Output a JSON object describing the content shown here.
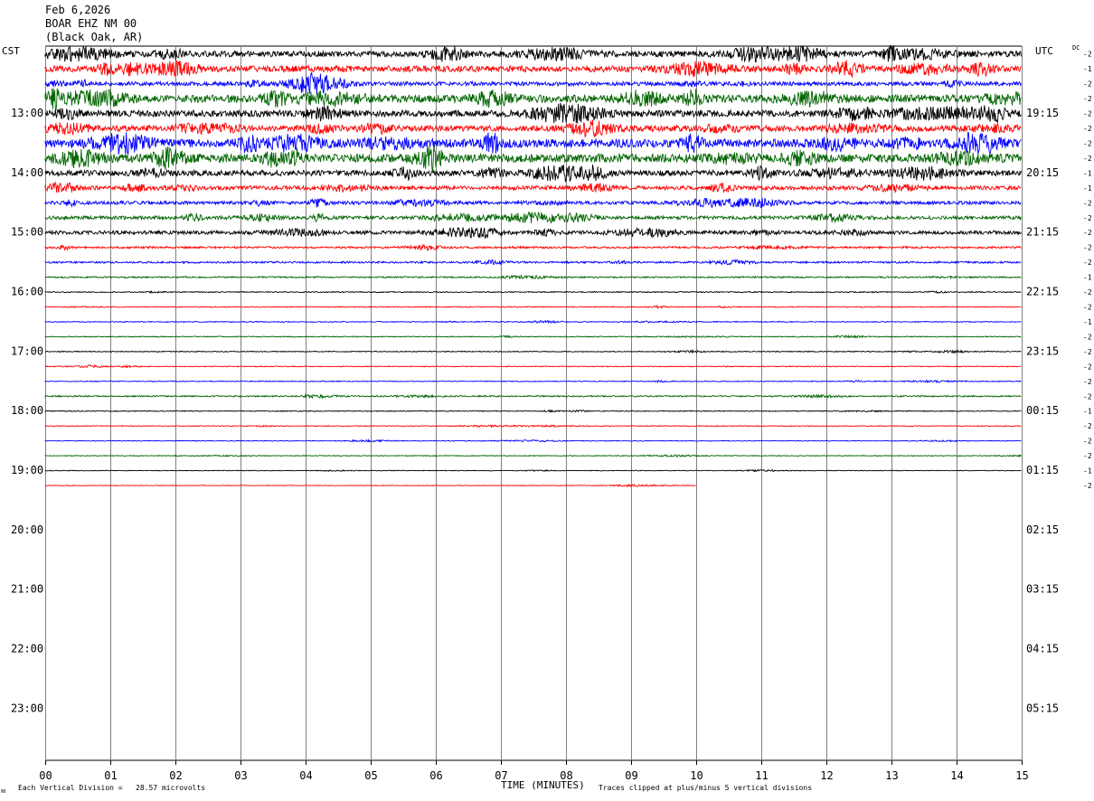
{
  "header": {
    "date": "Feb 6,2026",
    "station": "BOAR EHZ NM 00",
    "location": "(Black Oak, AR)"
  },
  "left_tz": "CST",
  "right_tz": "UTC",
  "dc_label": "DC",
  "footer": {
    "scale_note": "Each Vertical Division =   28.57 microvolts",
    "clip_note": "Traces clipped at plus/minus 5 vertical divisions",
    "corner_mark": "ᴍ"
  },
  "colors": {
    "cycle": [
      "#000000",
      "#ff0000",
      "#0000ff",
      "#006400"
    ],
    "grid": "#808080"
  },
  "chart_data": {
    "type": "line",
    "xlabel": "TIME (MINUTES)",
    "xlim": [
      0,
      15
    ],
    "x_ticks": [
      "00",
      "01",
      "02",
      "03",
      "04",
      "05",
      "06",
      "07",
      "08",
      "09",
      "10",
      "11",
      "12",
      "13",
      "14",
      "15"
    ],
    "hour_rows_total": 48,
    "rows_with_data": 30,
    "last_row_end_minute": 10,
    "left_hour_labels": [
      "13:00",
      "14:00",
      "15:00",
      "16:00",
      "17:00",
      "18:00",
      "19:00",
      "20:00",
      "21:00",
      "22:00",
      "23:00"
    ],
    "right_hour_labels": [
      "19:15",
      "20:15",
      "21:15",
      "22:15",
      "23:15",
      "00:15",
      "01:15",
      "02:15",
      "03:15",
      "04:15",
      "05:15"
    ],
    "dc_offsets": [
      "-2",
      "-1",
      "-2",
      "-2",
      "-2",
      "-2",
      "-2",
      "-2",
      "-1",
      "-1",
      "-2",
      "-2",
      "-2",
      "-2",
      "-2",
      "-1",
      "-2",
      "-2",
      "-1",
      "-2",
      "-2",
      "-2",
      "-2",
      "-2",
      "-1",
      "-2",
      "-2",
      "-2",
      "-1",
      "-2"
    ],
    "row_amplitudes": [
      3.2,
      3.4,
      2.2,
      4.2,
      3.6,
      3.2,
      4.6,
      4.6,
      3.0,
      2.2,
      1.8,
      1.9,
      2.0,
      1.1,
      1.0,
      0.8,
      0.55,
      0.5,
      0.5,
      0.5,
      0.5,
      0.45,
      0.45,
      0.75,
      0.45,
      0.4,
      0.4,
      0.4,
      0.4,
      0.35
    ]
  }
}
